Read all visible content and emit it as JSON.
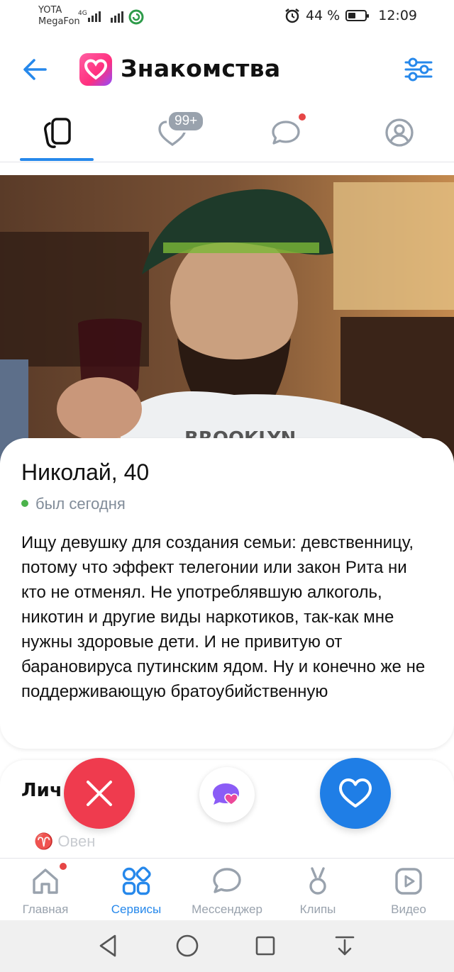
{
  "status_bar": {
    "carrier1": "YOTA",
    "carrier2": "MegaFon",
    "network": "4G",
    "battery": "44 %",
    "battery_level": 0.44,
    "time": "12:09"
  },
  "header": {
    "title": "Знакомства",
    "icons": [
      "arrow-left-icon",
      "app-logo-heart",
      "filter-sliders-icon"
    ]
  },
  "tabs": {
    "likes_badge": "99+",
    "items": [
      "cards-icon",
      "heart-icon",
      "chat-icon",
      "profile-icon"
    ],
    "active": 0
  },
  "profile": {
    "name": "Николай, 40",
    "status": "был сегодня",
    "bio": "Ищу девушку для создания семьи: девственницу, потому что эффект телегонии или закон Рита ни кто не отменял. Не употреблявшую алкоголь, никотин и другие виды наркотиков, так-как мне нужны здоровые дети. И не привитую от барановируса путинским ядом. Ну и конечно же не поддерживающую братоубийственную"
  },
  "details": {
    "section_title": "Лич",
    "zodiac": "Овен"
  },
  "actions": [
    "close-icon",
    "super-like-icon",
    "heart-icon"
  ],
  "bottom_nav": [
    {
      "label": "Главная",
      "icon": "home-icon"
    },
    {
      "label": "Сервисы",
      "icon": "services-grid-icon"
    },
    {
      "label": "Мессенджер",
      "icon": "message-icon"
    },
    {
      "label": "Клипы",
      "icon": "clips-icon"
    },
    {
      "label": "Видео",
      "icon": "video-icon"
    }
  ],
  "colors": {
    "accent": "#2688eb",
    "dislike": "#ef3b4e",
    "like": "#1f7ee6",
    "online": "#4bb34b"
  }
}
